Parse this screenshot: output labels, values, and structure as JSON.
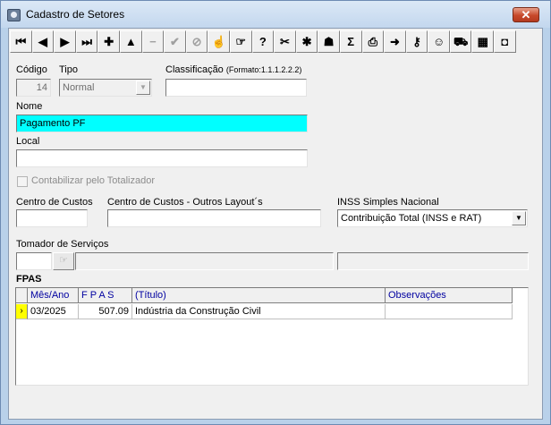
{
  "window": {
    "title": "Cadastro de Setores",
    "close_glyph": "✕"
  },
  "toolbar": {
    "buttons": [
      {
        "name": "first-record-button",
        "icon": "first-icon",
        "glyph": "⏮",
        "enabled": true
      },
      {
        "name": "prior-record-button",
        "icon": "prior-icon",
        "glyph": "◀",
        "enabled": true
      },
      {
        "name": "next-record-button",
        "icon": "next-icon",
        "glyph": "▶",
        "enabled": true
      },
      {
        "name": "last-record-button",
        "icon": "last-icon",
        "glyph": "⏭",
        "enabled": true
      },
      {
        "name": "insert-button",
        "icon": "plus-icon",
        "glyph": "✚",
        "enabled": true
      },
      {
        "name": "edit-button",
        "icon": "triangle-up-icon",
        "glyph": "▲",
        "enabled": true
      },
      {
        "name": "delete-button",
        "icon": "minus-icon",
        "glyph": "−",
        "enabled": false
      },
      {
        "name": "post-button",
        "icon": "checkmark-icon",
        "glyph": "✔",
        "enabled": false
      },
      {
        "name": "cancel-button",
        "icon": "cancel-icon",
        "glyph": "⊘",
        "enabled": false
      },
      {
        "name": "hand-button",
        "icon": "hand-icon",
        "glyph": "☝",
        "enabled": true
      },
      {
        "name": "goto-button",
        "icon": "pointing-hand-icon",
        "glyph": "☞",
        "enabled": true
      },
      {
        "name": "help-button",
        "icon": "help-icon",
        "glyph": "?",
        "enabled": true
      },
      {
        "name": "tools-button",
        "icon": "tools-icon",
        "glyph": "✂",
        "enabled": true
      },
      {
        "name": "report-button",
        "icon": "report-icon",
        "glyph": "✱",
        "enabled": true
      },
      {
        "name": "group-button",
        "icon": "group-icon",
        "glyph": "☗",
        "enabled": true
      },
      {
        "name": "sum-button",
        "icon": "sigma-icon",
        "glyph": "Σ",
        "enabled": true
      },
      {
        "name": "print-button",
        "icon": "print-icon",
        "glyph": "⎙",
        "enabled": true
      },
      {
        "name": "export-button",
        "icon": "export-icon",
        "glyph": "➜",
        "enabled": true
      },
      {
        "name": "key-button",
        "icon": "key-icon",
        "glyph": "⚷",
        "enabled": true
      },
      {
        "name": "users-button",
        "icon": "users-icon",
        "glyph": "☺",
        "enabled": true
      },
      {
        "name": "transport-button",
        "icon": "truck-icon",
        "glyph": "⛟",
        "enabled": true
      },
      {
        "name": "calendar-button",
        "icon": "calendar-icon",
        "glyph": "▦",
        "enabled": true
      },
      {
        "name": "exit-button",
        "icon": "exit-icon",
        "glyph": "◘",
        "enabled": true
      }
    ]
  },
  "form": {
    "codigo": {
      "label": "Código",
      "value": "14"
    },
    "tipo": {
      "label": "Tipo",
      "value": "Normal"
    },
    "classificacao": {
      "label": "Classificação",
      "format": "(Formato:1.1.1.2.2.2)",
      "value": ""
    },
    "nome": {
      "label": "Nome",
      "value": "Pagamento PF"
    },
    "local": {
      "label": "Local",
      "value": ""
    },
    "contabilizar": {
      "label": "Contabilizar pelo Totalizador",
      "checked": false
    },
    "centro_custos": {
      "label": "Centro de Custos",
      "value": ""
    },
    "centro_custos_outros": {
      "label": "Centro de Custos - Outros Layout´s",
      "value": ""
    },
    "inss": {
      "label": "INSS Simples Nacional",
      "value": "Contribuição Total (INSS e RAT)"
    },
    "tomador": {
      "label": "Tomador de Serviços",
      "value": "",
      "lookup_glyph": "☞"
    }
  },
  "fpas": {
    "title": "FPAS",
    "columns": [
      "Mês/Ano",
      "F P A S",
      "(Título)",
      "Observações"
    ],
    "rows": [
      {
        "indicator": "›",
        "mes_ano": "03/2025",
        "fpas": "507.09",
        "titulo": "Indústria da Construção Civil",
        "observacoes": ""
      }
    ]
  }
}
